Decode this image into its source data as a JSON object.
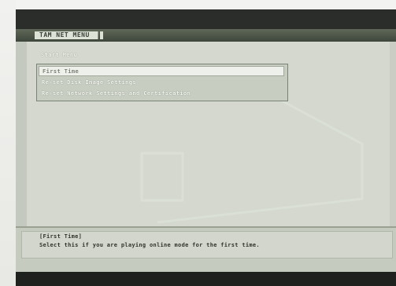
{
  "window": {
    "title_tab": "TAM NET MENU"
  },
  "start_menu": {
    "title": "Start Menu",
    "items": [
      {
        "label": "First Time",
        "selected": true
      },
      {
        "label": "Re-set Disk Image Settings",
        "selected": false
      },
      {
        "label": "Re-set Network Settings and Certification",
        "selected": false
      }
    ]
  },
  "description": {
    "title": "[First Time]",
    "text": "Select this if you are playing online mode for the first time."
  },
  "colors": {
    "top_bar": "#2b2d2a",
    "menu_background": "#d4d8cf",
    "selected_item": "#eef0eb",
    "bottom_bar": "#1f211f"
  }
}
